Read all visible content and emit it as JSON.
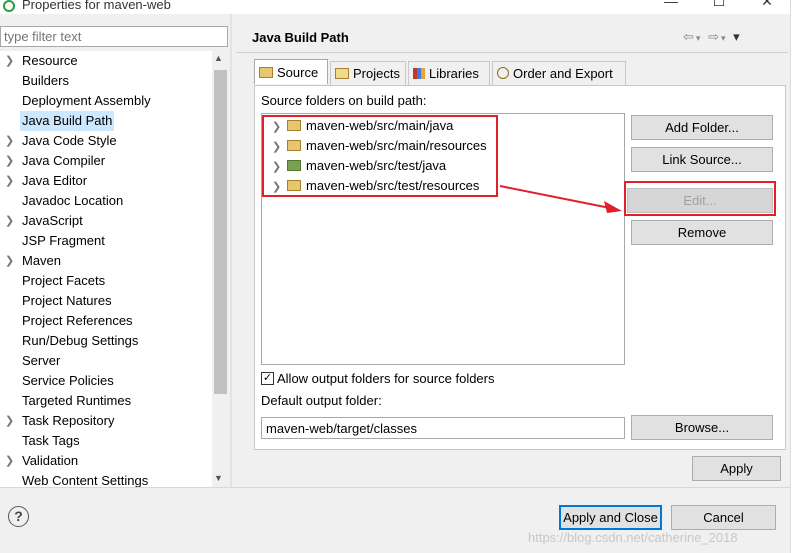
{
  "window": {
    "title": "Properties for maven-web",
    "minimize": "—",
    "maximize": "☐",
    "close": "✕"
  },
  "filter": {
    "placeholder": "type filter text"
  },
  "tree": {
    "items": [
      {
        "label": "Resource",
        "expandable": true
      },
      {
        "label": "Builders",
        "expandable": false
      },
      {
        "label": "Deployment Assembly",
        "expandable": false
      },
      {
        "label": "Java Build Path",
        "expandable": false,
        "selected": true
      },
      {
        "label": "Java Code Style",
        "expandable": true
      },
      {
        "label": "Java Compiler",
        "expandable": true
      },
      {
        "label": "Java Editor",
        "expandable": true
      },
      {
        "label": "Javadoc Location",
        "expandable": false
      },
      {
        "label": "JavaScript",
        "expandable": true
      },
      {
        "label": "JSP Fragment",
        "expandable": false
      },
      {
        "label": "Maven",
        "expandable": true
      },
      {
        "label": "Project Facets",
        "expandable": false
      },
      {
        "label": "Project Natures",
        "expandable": false
      },
      {
        "label": "Project References",
        "expandable": false
      },
      {
        "label": "Run/Debug Settings",
        "expandable": false
      },
      {
        "label": "Server",
        "expandable": false
      },
      {
        "label": "Service Policies",
        "expandable": false
      },
      {
        "label": "Targeted Runtimes",
        "expandable": false
      },
      {
        "label": "Task Repository",
        "expandable": true
      },
      {
        "label": "Task Tags",
        "expandable": false
      },
      {
        "label": "Validation",
        "expandable": true
      },
      {
        "label": "Web Content Settings",
        "expandable": false
      }
    ]
  },
  "page": {
    "title": "Java Build Path"
  },
  "tabs": [
    {
      "label": "Source",
      "active": true
    },
    {
      "label": "Projects",
      "active": false
    },
    {
      "label": "Libraries",
      "active": false
    },
    {
      "label": "Order and Export",
      "active": false
    }
  ],
  "source": {
    "list_label": "Source folders on build path:",
    "folders": [
      {
        "path": "maven-web/src/main/java",
        "kind": "main"
      },
      {
        "path": "maven-web/src/main/resources",
        "kind": "main"
      },
      {
        "path": "maven-web/src/test/java",
        "kind": "test"
      },
      {
        "path": "maven-web/src/test/resources",
        "kind": "main"
      }
    ],
    "add_folder": "Add Folder...",
    "link_source": "Link Source...",
    "edit": "Edit...",
    "remove": "Remove",
    "allow_output_label": "Allow output folders for source folders",
    "allow_output_checked": true,
    "default_output_label": "Default output folder:",
    "default_output_value": "maven-web/target/classes",
    "browse": "Browse..."
  },
  "buttons": {
    "apply": "Apply",
    "apply_and_close": "Apply and Close",
    "cancel": "Cancel"
  },
  "watermark": "https://blog.csdn.net/catherine_2018",
  "colors": {
    "selection": "#cce8ff",
    "highlight_box": "#e0202a",
    "default_button_border": "#0078d7"
  }
}
